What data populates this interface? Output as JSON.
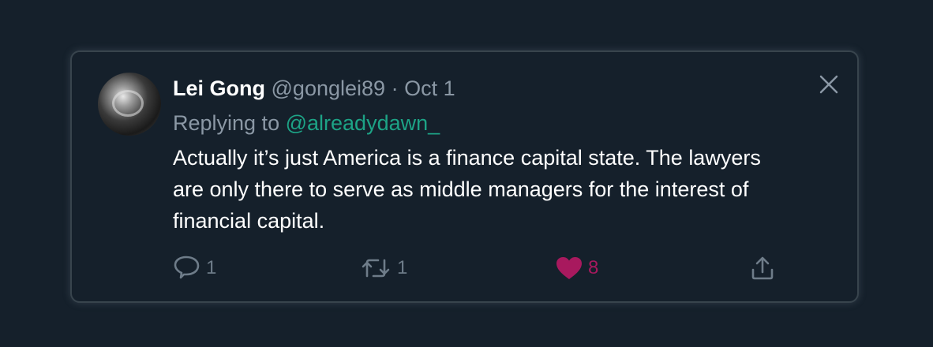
{
  "tweet": {
    "author_name": "Lei Gong",
    "handle": "@gonglei89",
    "separator": "·",
    "date": "Oct 1",
    "replying_prefix": "Replying to",
    "replying_to": "@alreadydawn_",
    "text": "Actually it’s just America is a finance capital state. The lawyers are only there to serve as middle managers for the interest of financial capital."
  },
  "actions": {
    "reply_count": "1",
    "retweet_count": "1",
    "like_count": "8"
  },
  "icons": {
    "close": "close-icon",
    "reply": "reply-icon",
    "retweet": "retweet-icon",
    "like": "heart-icon",
    "share": "share-icon"
  },
  "colors": {
    "background": "#15202b",
    "border": "#38444d",
    "secondary_text": "#8b98a5",
    "mention": "#1da386",
    "like": "#a8195e"
  }
}
